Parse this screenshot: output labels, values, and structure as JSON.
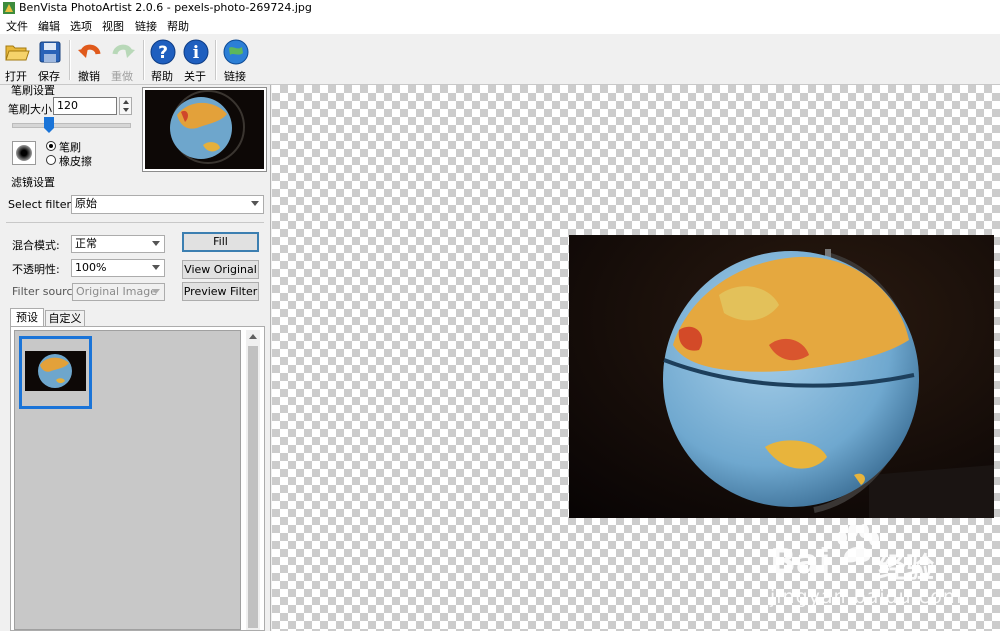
{
  "window": {
    "title": "BenVista PhotoArtist 2.0.6 - pexels-photo-269724.jpg"
  },
  "menu": [
    "文件",
    "编辑",
    "选项",
    "视图",
    "链接",
    "帮助"
  ],
  "toolbar": {
    "open": "打开",
    "save": "保存",
    "undo": "撤销",
    "redo": "重做",
    "help": "帮助",
    "about": "关于",
    "link": "链接"
  },
  "brush": {
    "group_title": "笔刷设置",
    "size_label": "笔刷大小:",
    "size_value": "120",
    "slider_fraction": 0.3,
    "mode_brush": "笔刷",
    "mode_eraser": "橡皮擦",
    "selected_mode": "brush"
  },
  "filter": {
    "group_title": "滤镜设置",
    "select_label": "Select filter:",
    "select_value": "原始",
    "blend_label": "混合模式:",
    "blend_value": "正常",
    "opacity_label": "不透明性:",
    "opacity_value": "100%",
    "source_label": "Filter source:",
    "source_value": "Original Image",
    "fill_button": "Fill",
    "view_original_button": "View Original",
    "preview_filter_button": "Preview Filter"
  },
  "tabs": [
    "预设",
    "自定义"
  ],
  "active_tab": "预设",
  "watermark": {
    "brand": "Bai",
    "brand_tail": "经验",
    "url": "jingyan.baidu.com"
  },
  "colors": {
    "selection_blue": "#1a74d8",
    "help_blue": "#1f5fbf"
  }
}
